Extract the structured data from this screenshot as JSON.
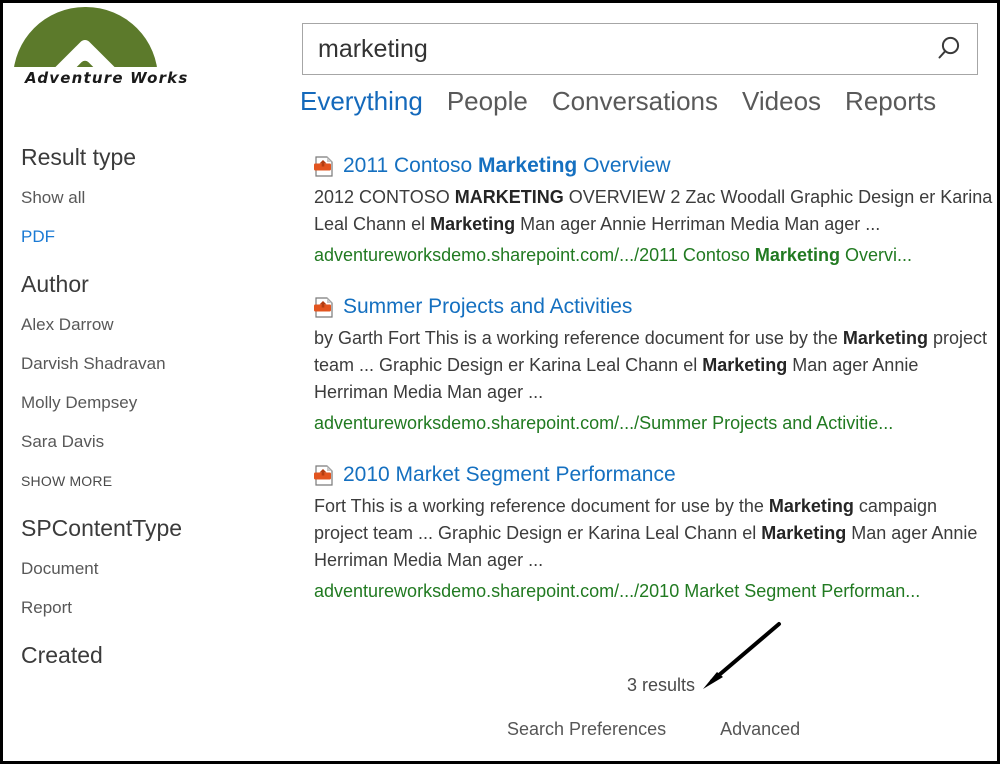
{
  "brand": {
    "logo_icon": "adventure-works-dome-logo",
    "wordmark": "Adventure Works",
    "logo_color": "#5c7a2b"
  },
  "colors": {
    "accent_blue": "#1570c0",
    "link_blue": "#1a7ad4",
    "url_green": "#217a21",
    "text_gray": "#3c3c3c"
  },
  "search": {
    "value": "marketing",
    "placeholder": "Search this site",
    "icon": "search-icon"
  },
  "tabs": [
    {
      "label": "Everything",
      "active": true
    },
    {
      "label": "People",
      "active": false
    },
    {
      "label": "Conversations",
      "active": false
    },
    {
      "label": "Videos",
      "active": false
    },
    {
      "label": "Reports",
      "active": false
    }
  ],
  "sidebar": {
    "groups": [
      {
        "title": "Result type",
        "items": [
          {
            "label": "Show all",
            "selected": false
          },
          {
            "label": "PDF",
            "selected": true
          }
        ]
      },
      {
        "title": "Author",
        "items": [
          {
            "label": "Alex Darrow",
            "selected": false
          },
          {
            "label": "Darvish Shadravan",
            "selected": false
          },
          {
            "label": "Molly Dempsey",
            "selected": false
          },
          {
            "label": "Sara Davis",
            "selected": false
          },
          {
            "label": "SHOW MORE",
            "selected": false,
            "showmore": true
          }
        ]
      },
      {
        "title": "SPContentType",
        "items": [
          {
            "label": "Document",
            "selected": false
          },
          {
            "label": "Report",
            "selected": false
          }
        ]
      },
      {
        "title": "Created",
        "items": []
      }
    ]
  },
  "results": [
    {
      "icon": "pdf-document-icon",
      "title_parts": [
        {
          "text": "2011 Contoso ",
          "bold": false
        },
        {
          "text": "Marketing",
          "bold": true
        },
        {
          "text": " Overview",
          "bold": false
        }
      ],
      "snippet_parts": [
        {
          "text": "2012 CONTOSO ",
          "bold": false
        },
        {
          "text": "MARKETING",
          "bold": true
        },
        {
          "text": " OVERVIEW 2 Zac Woodall Graphic Design er Karina Leal Chann el ",
          "bold": false
        },
        {
          "text": "Marketing",
          "bold": true
        },
        {
          "text": " Man ager Annie Herriman Media Man ager ...",
          "bold": false
        }
      ],
      "url_parts": [
        {
          "text": "adventureworksdemo.sharepoint.com/.../2011 Contoso ",
          "bold": false
        },
        {
          "text": "Marketing",
          "bold": true
        },
        {
          "text": " Overvi...",
          "bold": false
        }
      ]
    },
    {
      "icon": "pdf-document-icon",
      "title_parts": [
        {
          "text": "Summer Projects and Activities",
          "bold": false
        }
      ],
      "snippet_parts": [
        {
          "text": "by Garth Fort This is a working reference document for use by the ",
          "bold": false
        },
        {
          "text": "Marketing",
          "bold": true
        },
        {
          "text": " project team ... Graphic Design er Karina Leal Chann el ",
          "bold": false
        },
        {
          "text": "Marketing",
          "bold": true
        },
        {
          "text": " Man ager Annie Herriman Media Man ager ...",
          "bold": false
        }
      ],
      "url_parts": [
        {
          "text": "adventureworksdemo.sharepoint.com/.../Summer Projects and Activitie...",
          "bold": false
        }
      ]
    },
    {
      "icon": "pdf-document-icon",
      "title_parts": [
        {
          "text": "2010 Market Segment Performance",
          "bold": false
        }
      ],
      "snippet_parts": [
        {
          "text": "Fort This is a working reference document for use by the ",
          "bold": false
        },
        {
          "text": "Marketing",
          "bold": true
        },
        {
          "text": " campaign project team ... Graphic Design er Karina Leal Chann el ",
          "bold": false
        },
        {
          "text": "Marketing",
          "bold": true
        },
        {
          "text": " Man ager Annie Herriman Media Man ager ...",
          "bold": false
        }
      ],
      "url_parts": [
        {
          "text": "adventureworksdemo.sharepoint.com/.../2010 Market Segment Performan...",
          "bold": false
        }
      ]
    }
  ],
  "footer": {
    "result_count": "3 results",
    "links": [
      {
        "label": "Search Preferences"
      },
      {
        "label": "Advanced"
      }
    ]
  },
  "annotation": {
    "type": "arrow",
    "points_at": "3 results"
  }
}
